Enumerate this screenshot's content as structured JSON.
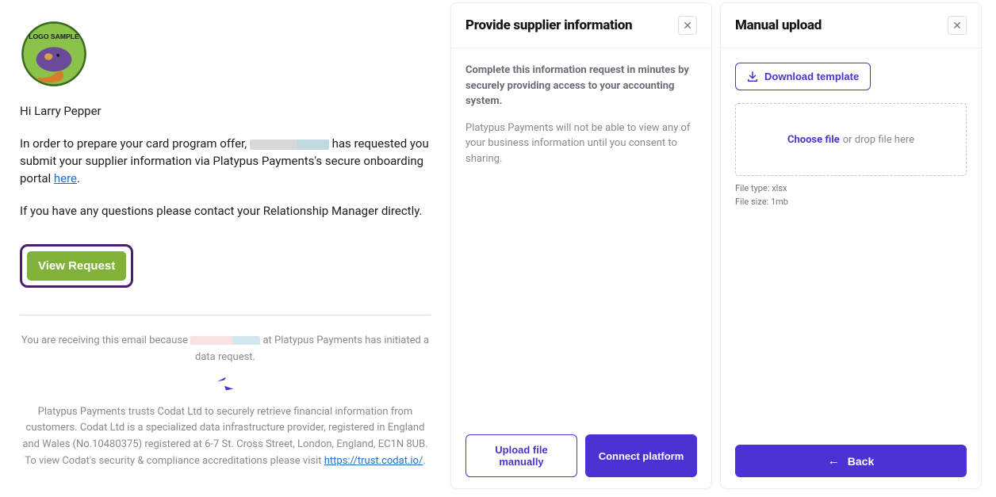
{
  "email": {
    "greeting": "Hi Larry Pepper",
    "body_prefix": "In order to prepare your card program offer, ",
    "body_suffix": " has requested you submit your supplier information via Platypus Payments's secure onboarding portal ",
    "here_link": "here",
    "questions": "If you have any questions please contact your Relationship Manager directly.",
    "view_request": "View Request",
    "footer_line1_prefix": "You are receiving this email because ",
    "footer_line1_suffix": " at Platypus Payments has initiated a data request.",
    "footer_line2": "Platypus Payments trusts Codat Ltd to securely retrieve financial information from customers. Codat Ltd is a specialized data infrastructure provider, registered in England and Wales (No.10480375) registered at 6-7 St. Cross Street, London, England, EC1N 8UB. To view Codat's security & compliance accreditations please visit ",
    "footer_link": "https://trust.codat.io/"
  },
  "middle": {
    "title": "Provide supplier information",
    "info_bold": "Complete this information request in minutes by securely providing access to your accounting system.",
    "info_text": "Platypus Payments will not be able to view any of your business information until you consent to sharing.",
    "upload_manual": "Upload file manually",
    "connect": "Connect platform"
  },
  "right": {
    "title": "Manual upload",
    "download_template": "Download template",
    "choose_file": "Choose file",
    "drop_hint": "or drop file here",
    "file_type": "File type: xlsx",
    "file_size": "File size: 1mb",
    "back": "Back"
  }
}
